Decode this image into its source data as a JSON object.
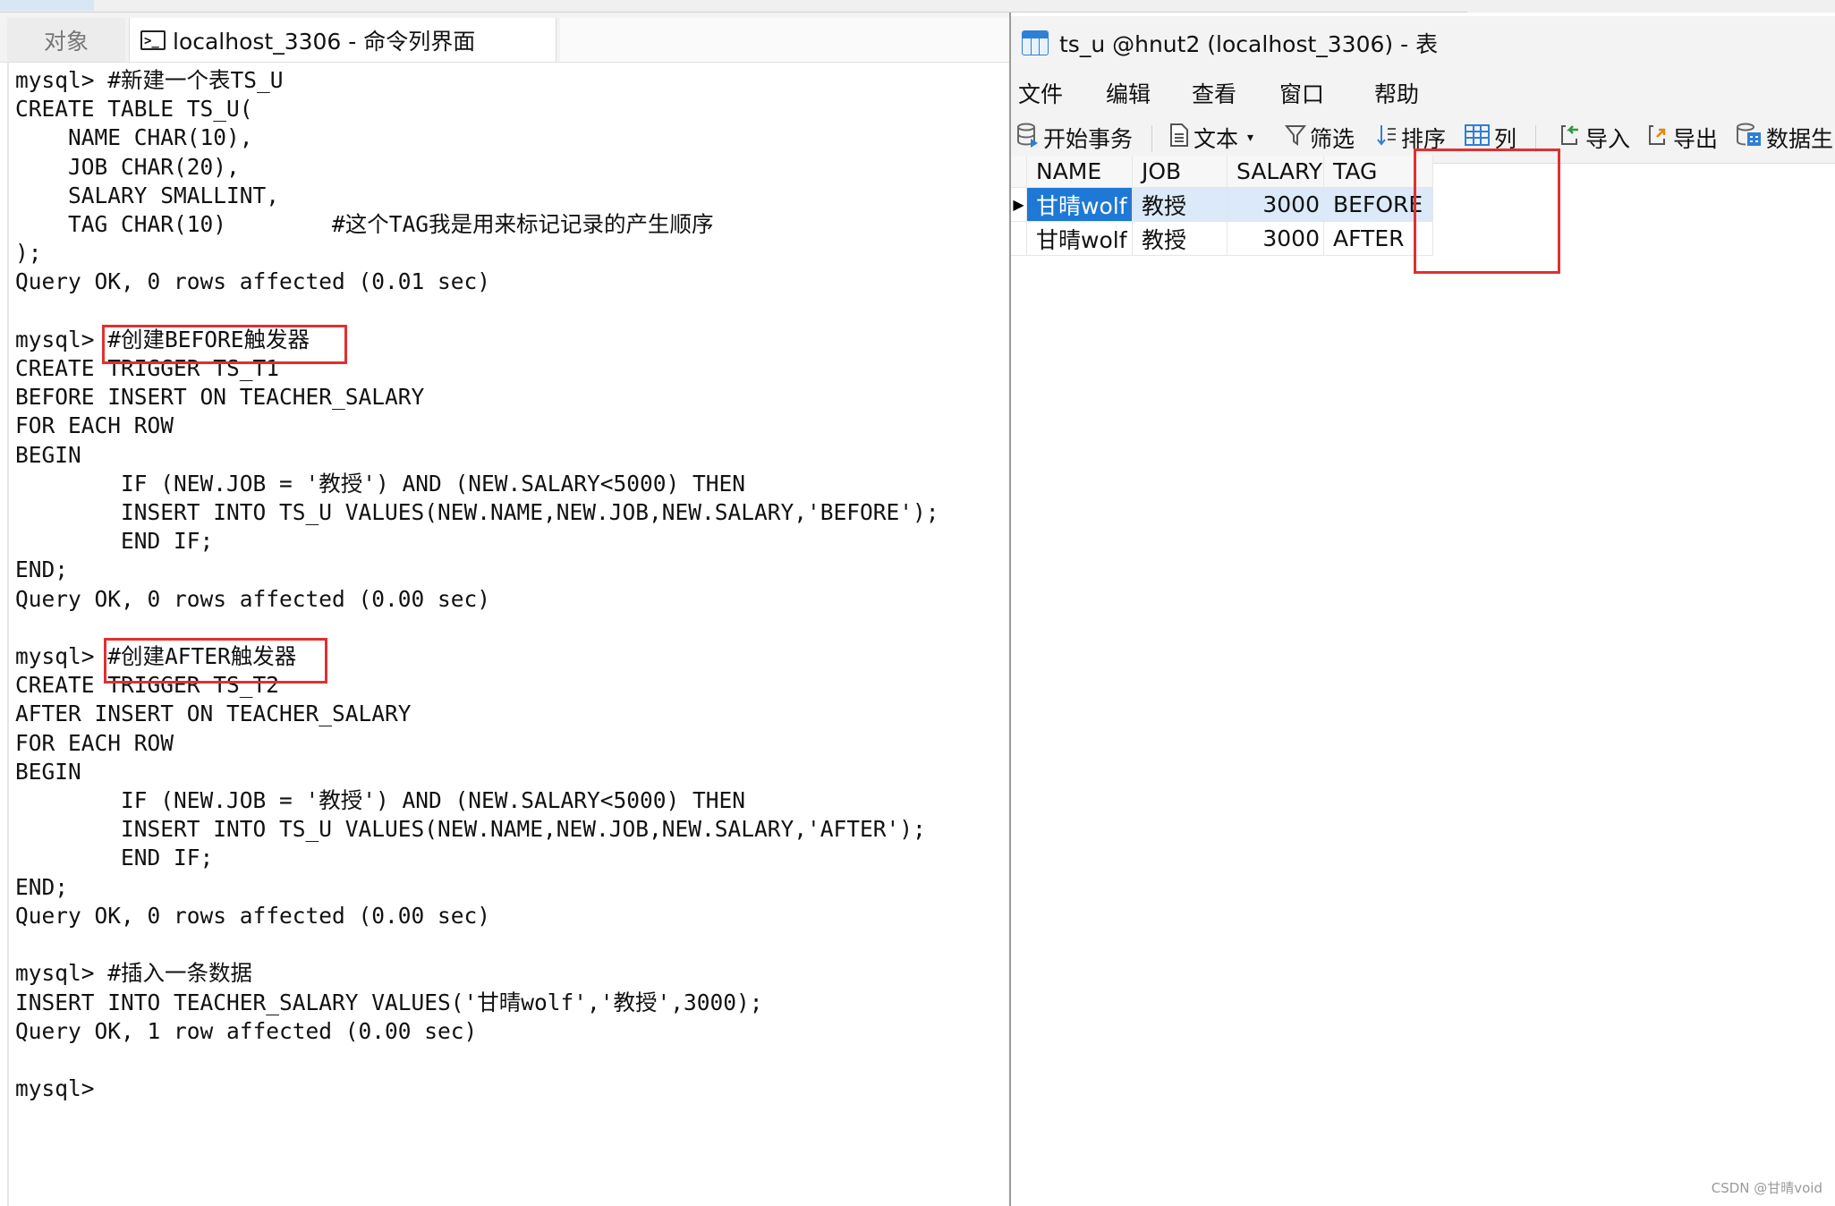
{
  "left_window": {
    "tabs": {
      "objects": "对象",
      "console": "localhost_3306 - 命令列界面"
    },
    "terminal_text": "mysql> #新建一个表TS_U\nCREATE TABLE TS_U(\n    NAME CHAR(10),\n    JOB CHAR(20),\n    SALARY SMALLINT,\n    TAG CHAR(10)        #这个TAG我是用来标记记录的产生顺序\n);\nQuery OK, 0 rows affected (0.01 sec)\n\nmysql> #创建BEFORE触发器\nCREATE TRIGGER TS_T1\nBEFORE INSERT ON TEACHER_SALARY\nFOR EACH ROW\nBEGIN\n        IF (NEW.JOB = '教授') AND (NEW.SALARY<5000) THEN\n        INSERT INTO TS_U VALUES(NEW.NAME,NEW.JOB,NEW.SALARY,'BEFORE');\n        END IF;\nEND;\nQuery OK, 0 rows affected (0.00 sec)\n\nmysql> #创建AFTER触发器\nCREATE TRIGGER TS_T2\nAFTER INSERT ON TEACHER_SALARY\nFOR EACH ROW\nBEGIN\n        IF (NEW.JOB = '教授') AND (NEW.SALARY<5000) THEN\n        INSERT INTO TS_U VALUES(NEW.NAME,NEW.JOB,NEW.SALARY,'AFTER');\n        END IF;\nEND;\nQuery OK, 0 rows affected (0.00 sec)\n\nmysql> #插入一条数据\nINSERT INTO TEACHER_SALARY VALUES('甘晴wolf','教授',3000);\nQuery OK, 1 row affected (0.00 sec)\n\nmysql>"
  },
  "right_window": {
    "title": "ts_u @hnut2 (localhost_3306) - 表",
    "menu": [
      "文件",
      "编辑",
      "查看",
      "窗口",
      "帮助"
    ],
    "toolbar": {
      "begin_transaction": "开始事务",
      "text": "文本",
      "filter": "筛选",
      "sort": "排序",
      "columns": "列",
      "import": "导入",
      "export": "导出",
      "data_gen": "数据生"
    },
    "grid": {
      "columns": [
        "NAME",
        "JOB",
        "SALARY",
        "TAG"
      ],
      "rows": [
        [
          "甘晴wolf",
          "教授",
          "3000",
          "BEFORE"
        ],
        [
          "甘晴wolf",
          "教授",
          "3000",
          "AFTER"
        ]
      ]
    }
  },
  "watermark": "CSDN @甘晴void",
  "colors": {
    "highlight_box": "#e03030",
    "selection": "#1e78d6",
    "selected_row": "#dbe9f8"
  }
}
